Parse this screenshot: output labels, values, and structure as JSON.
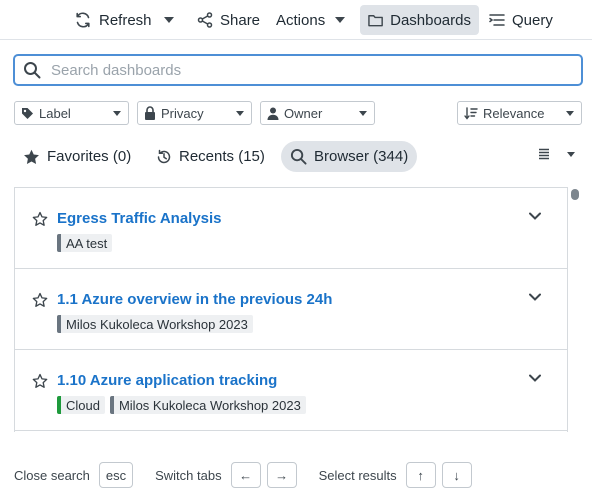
{
  "toolbar": {
    "refresh_label": "Refresh",
    "share_label": "Share",
    "actions_label": "Actions",
    "dashboards_label": "Dashboards",
    "query_label": "Query"
  },
  "search": {
    "placeholder": "Search dashboards",
    "value": ""
  },
  "filters": {
    "label": "Label",
    "privacy": "Privacy",
    "owner": "Owner",
    "sort": "Relevance"
  },
  "tabs": {
    "favorites": "Favorites (0)",
    "recents": "Recents (15)",
    "browser": "Browser (344)",
    "active": "browser"
  },
  "results": [
    {
      "title": "Egress Traffic Analysis",
      "tags": [
        {
          "label": "AA test",
          "color": "#6a7580"
        }
      ]
    },
    {
      "title": "1.1 Azure overview in the previous 24h",
      "tags": [
        {
          "label": "Milos Kukoleca Workshop 2023",
          "color": "#6a7580"
        }
      ]
    },
    {
      "title": "1.10 Azure application tracking",
      "tags": [
        {
          "label": "Cloud",
          "color": "#1e9a3c"
        },
        {
          "label": "Milos Kukoleca Workshop 2023",
          "color": "#6a7580"
        }
      ]
    }
  ],
  "footer": {
    "close_label": "Close search",
    "close_key": "esc",
    "switch_label": "Switch tabs",
    "switch_left": "←",
    "switch_right": "→",
    "select_label": "Select results",
    "select_up": "↑",
    "select_down": "↓"
  },
  "colors": {
    "accent": "#4d8fd6",
    "link": "#1a73c9",
    "active_bg": "#dfe3e8",
    "tag_default": "#6a7580",
    "tag_cloud": "#1e9a3c"
  },
  "icons": [
    "refresh-icon",
    "share-icon",
    "caret-down-icon",
    "folder-icon",
    "query-icon",
    "search-icon",
    "tag-icon",
    "lock-icon",
    "user-icon",
    "sort-icon",
    "star-icon",
    "history-icon",
    "list-icon",
    "chevron-down-icon"
  ]
}
